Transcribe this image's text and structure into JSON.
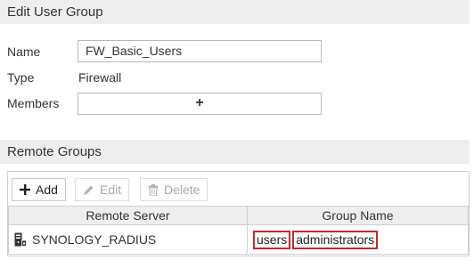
{
  "edit_section": {
    "title": "Edit User Group",
    "name_label": "Name",
    "name_value": "FW_Basic_Users",
    "type_label": "Type",
    "type_value": "Firewall",
    "members_label": "Members",
    "members_add_symbol": "+"
  },
  "remote_section": {
    "title": "Remote Groups",
    "toolbar": {
      "add_label": "Add",
      "edit_label": "Edit",
      "delete_label": "Delete"
    },
    "columns": [
      "Remote Server",
      "Group Name"
    ],
    "rows": [
      {
        "server": "SYNOLOGY_RADIUS",
        "groups": [
          "users",
          "administrators"
        ]
      }
    ]
  },
  "colors": {
    "header_bg": "#eeeeee",
    "highlight_border": "#c62828",
    "disabled_text": "#a8a8a8"
  },
  "icons": {
    "add": "plus-icon",
    "edit": "pencil-icon",
    "delete": "trash-icon",
    "server": "server-icon"
  }
}
